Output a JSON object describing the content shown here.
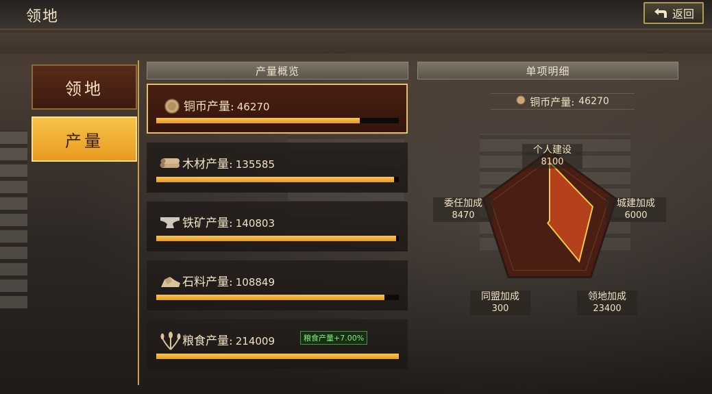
{
  "header": {
    "title": "领地",
    "back_label": "返回"
  },
  "tabs": [
    {
      "label": "领地",
      "active": false
    },
    {
      "label": "产量",
      "active": true
    }
  ],
  "sections": {
    "overview_title": "产量概览",
    "detail_title": "单项明细"
  },
  "production": [
    {
      "label": "铜币产量:",
      "value": "46270",
      "icon": "coin-icon",
      "fill": 0.84,
      "selected": true
    },
    {
      "label": "木材产量:",
      "value": "135585",
      "icon": "wood-icon",
      "fill": 0.98
    },
    {
      "label": "铁矿产量:",
      "value": "140803",
      "icon": "anvil-icon",
      "fill": 0.99
    },
    {
      "label": "石料产量:",
      "value": "108849",
      "icon": "stone-icon",
      "fill": 0.94
    },
    {
      "label": "粮食产量:",
      "value": "214009",
      "icon": "wheat-icon",
      "fill": 1.0,
      "bonus": "粮食产量+7.00%"
    }
  ],
  "detail": {
    "label": "铜币产量:",
    "value": "46270"
  },
  "radar": {
    "axes": [
      {
        "label": "个人建设",
        "value": "8100",
        "ratio": 0.93
      },
      {
        "label": "城建加成",
        "value": "6000",
        "ratio": 0.72
      },
      {
        "label": "领地加成",
        "value": "23400",
        "ratio": 0.8
      },
      {
        "label": "同盟加成",
        "value": "300",
        "ratio": 0.05
      },
      {
        "label": "委任加成",
        "value": "8470",
        "ratio": 0.0
      }
    ],
    "colors": {
      "fill": "#b5401c",
      "stroke": "#f2c94c",
      "frame": "#4a1e12"
    }
  }
}
